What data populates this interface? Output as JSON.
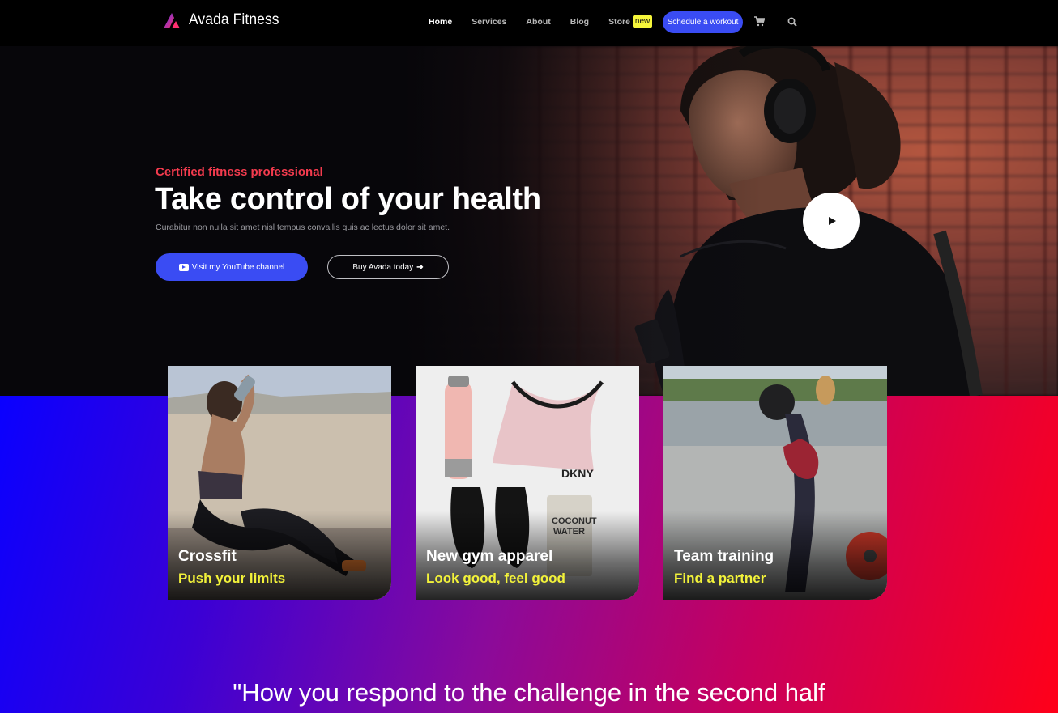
{
  "nav": {
    "brand": "Avada Fitness",
    "items": [
      {
        "label": "Home",
        "active": true
      },
      {
        "label": "Services",
        "active": false
      },
      {
        "label": "About",
        "active": false
      },
      {
        "label": "Blog",
        "active": false
      }
    ],
    "store": {
      "label": "Store",
      "badge": "new"
    },
    "cta": "Schedule a workout",
    "icons": [
      "cart-icon",
      "search-icon"
    ]
  },
  "hero": {
    "eyebrow": "Certified fitness professional",
    "headline": "Take control of your health",
    "subtext": "Curabitur non nulla sit amet nisl tempus convallis quis ac lectus dolor sit amet.",
    "primary_button": "Visit my YouTube channel",
    "secondary_button": "Buy Avada today",
    "play_icon": "play-icon"
  },
  "cards": [
    {
      "title": "Crossfit",
      "subtitle": "Push your limits"
    },
    {
      "title": "New gym apparel",
      "subtitle": "Look good, feel good"
    },
    {
      "title": "Team training",
      "subtitle": "Find a partner"
    }
  ],
  "quote": "\"How you respond to the challenge in the second half",
  "colors": {
    "accent_blue": "#3a4cf3",
    "eyebrow_red": "#f33b4e",
    "card_subtitle_yellow": "#f2f23a",
    "badge_yellow": "#f5f53a"
  }
}
